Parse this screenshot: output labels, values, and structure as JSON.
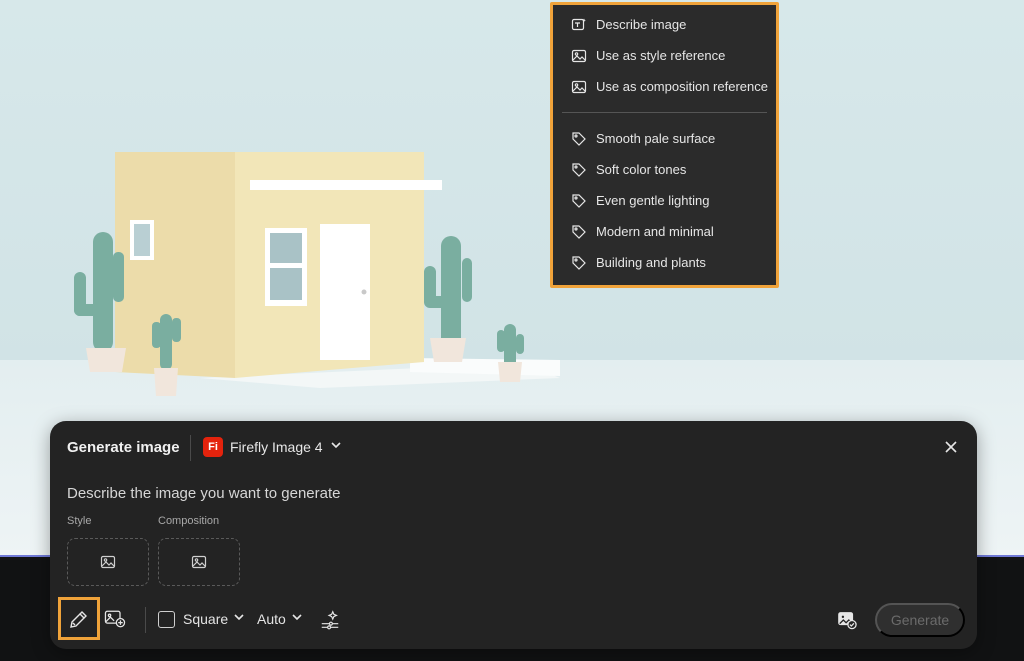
{
  "context_menu": {
    "actions": [
      {
        "icon": "describe-image-icon",
        "label": "Describe image"
      },
      {
        "icon": "image-icon",
        "label": "Use as style reference"
      },
      {
        "icon": "image-icon",
        "label": "Use as composition reference"
      }
    ],
    "tags": [
      {
        "icon": "tag-icon",
        "label": "Smooth pale surface"
      },
      {
        "icon": "tag-icon",
        "label": "Soft color tones"
      },
      {
        "icon": "tag-icon",
        "label": "Even gentle lighting"
      },
      {
        "icon": "tag-icon",
        "label": "Modern and minimal"
      },
      {
        "icon": "tag-icon",
        "label": "Building and plants"
      }
    ]
  },
  "panel": {
    "title": "Generate image",
    "model": {
      "badge": "Fi",
      "label": "Firefly Image 4",
      "badge_color": "#e4230d"
    },
    "prompt_placeholder": "Describe the image you want to generate",
    "style_label": "Style",
    "composition_label": "Composition",
    "toolbar": {
      "aspect_label": "Square",
      "content_type_label": "Auto",
      "generate_label": "Generate"
    }
  },
  "colors": {
    "highlight": "#f0a33a",
    "panel_bg": "#232323",
    "menu_bg": "#2b2b2b",
    "accent_line": "#6f79d6"
  }
}
